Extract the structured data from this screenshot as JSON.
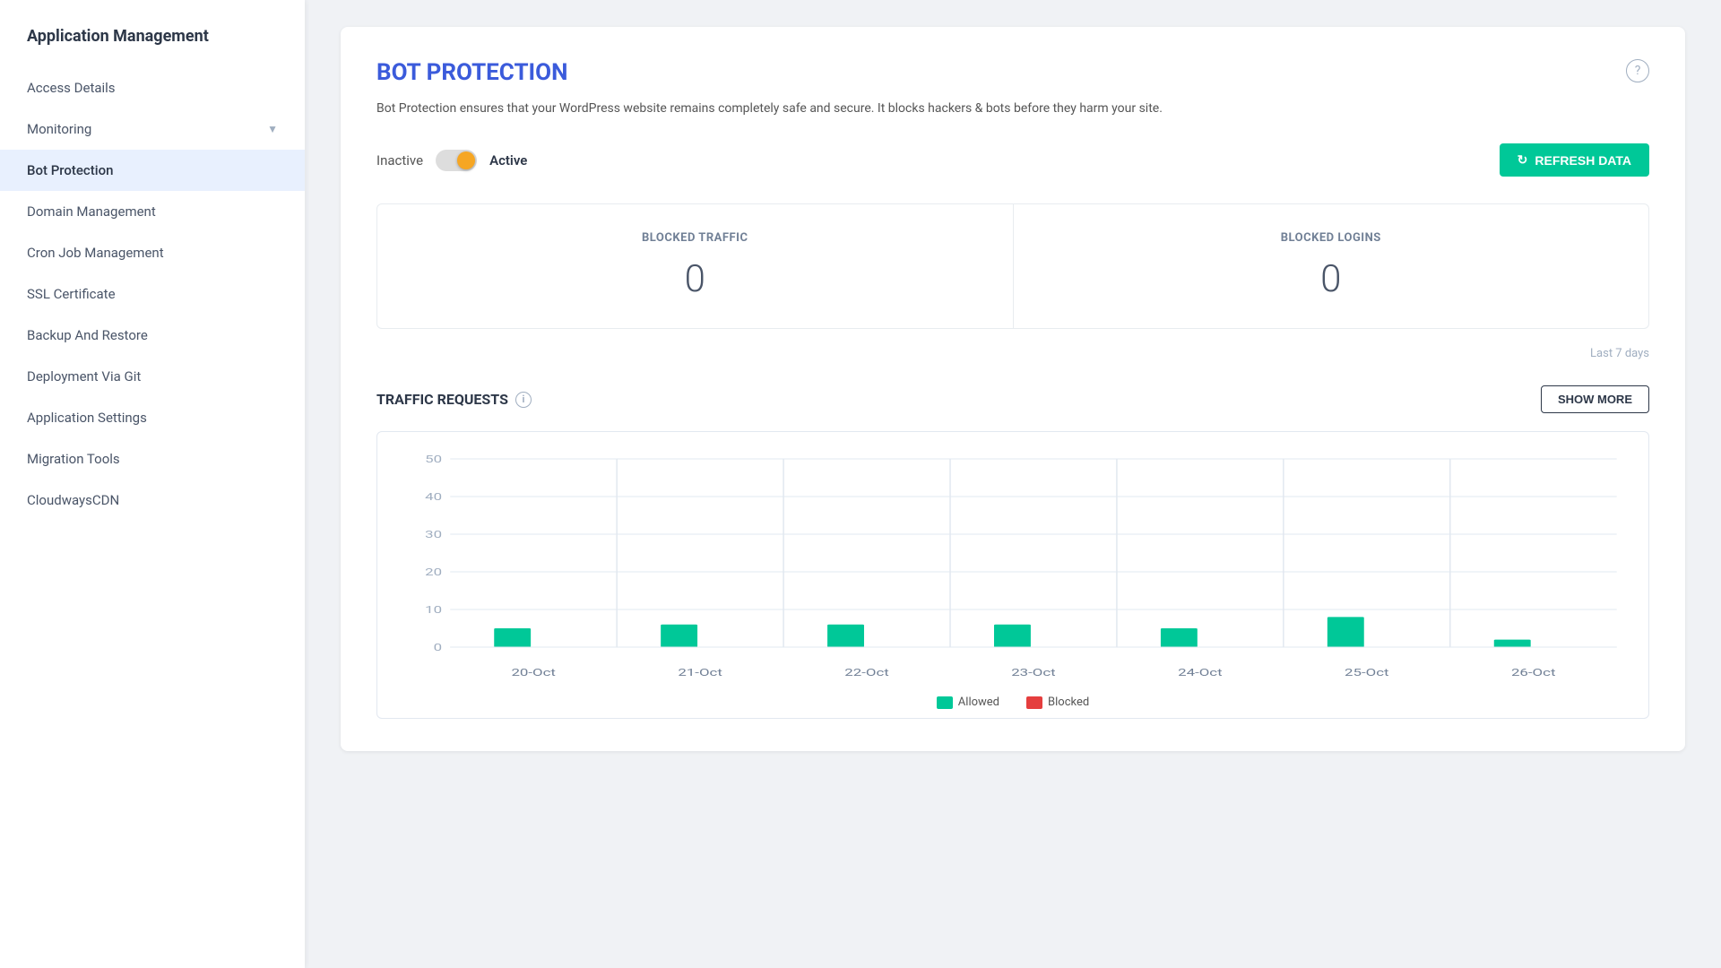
{
  "sidebar": {
    "title": "Application Management",
    "items": [
      {
        "id": "access-details",
        "label": "Access Details",
        "active": false,
        "hasChevron": false
      },
      {
        "id": "monitoring",
        "label": "Monitoring",
        "active": false,
        "hasChevron": true
      },
      {
        "id": "bot-protection",
        "label": "Bot Protection",
        "active": true,
        "hasChevron": false
      },
      {
        "id": "domain-management",
        "label": "Domain Management",
        "active": false,
        "hasChevron": false
      },
      {
        "id": "cron-job-management",
        "label": "Cron Job Management",
        "active": false,
        "hasChevron": false
      },
      {
        "id": "ssl-certificate",
        "label": "SSL Certificate",
        "active": false,
        "hasChevron": false
      },
      {
        "id": "backup-and-restore",
        "label": "Backup And Restore",
        "active": false,
        "hasChevron": false
      },
      {
        "id": "deployment-via-git",
        "label": "Deployment Via Git",
        "active": false,
        "hasChevron": false
      },
      {
        "id": "application-settings",
        "label": "Application Settings",
        "active": false,
        "hasChevron": false
      },
      {
        "id": "migration-tools",
        "label": "Migration Tools",
        "active": false,
        "hasChevron": false
      },
      {
        "id": "cloudways-cdn",
        "label": "CloudwaysCDN",
        "active": false,
        "hasChevron": false
      }
    ]
  },
  "main": {
    "title": "BOT PROTECTION",
    "description": "Bot Protection ensures that your WordPress website remains completely safe and secure. It blocks hackers & bots before they harm your site.",
    "toggle": {
      "inactive_label": "Inactive",
      "active_label": "Active",
      "is_active": true
    },
    "refresh_button": "REFRESH DATA",
    "stats": {
      "blocked_traffic_label": "BLOCKED TRAFFIC",
      "blocked_traffic_value": "0",
      "blocked_logins_label": "BLOCKED LOGINS",
      "blocked_logins_value": "0",
      "period_label": "Last 7 days"
    },
    "traffic_section": {
      "title": "TRAFFIC REQUESTS",
      "show_more_label": "SHOW MORE"
    },
    "chart": {
      "y_labels": [
        "50",
        "40",
        "30",
        "20",
        "10",
        "0"
      ],
      "x_labels": [
        "20-Oct",
        "21-Oct",
        "22-Oct",
        "23-Oct",
        "24-Oct",
        "25-Oct",
        "26-Oct"
      ],
      "allowed_data": [
        5,
        6,
        6,
        6,
        5,
        8,
        2
      ],
      "blocked_data": [
        0,
        0,
        0,
        0,
        0,
        0,
        0
      ],
      "legend": {
        "allowed_label": "Allowed",
        "blocked_label": "Blocked",
        "allowed_color": "#00c898",
        "blocked_color": "#e53e3e"
      }
    }
  }
}
